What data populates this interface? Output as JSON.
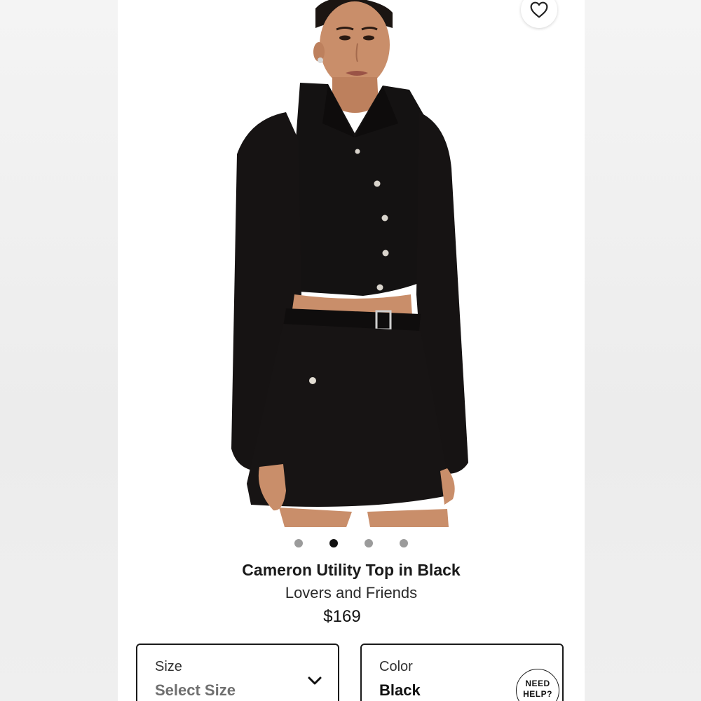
{
  "product": {
    "title": "Cameron Utility Top in Black",
    "brand": "Lovers and Friends",
    "price": "$169",
    "image_alt": "Model wearing black cropped utility top with matching mini skirt"
  },
  "gallery": {
    "total": 4,
    "active_index": 1
  },
  "size_selector": {
    "label": "Size",
    "value": "Select Size"
  },
  "color_selector": {
    "label": "Color",
    "value": "Black"
  },
  "help": {
    "line1": "NEED",
    "line2": "HELP?"
  },
  "icons": {
    "favorite": "heart-outline-icon",
    "dropdown": "chevron-down-icon"
  },
  "colors": {
    "garment": "#141212",
    "skin": "#c98e6a",
    "text": "#1a1a1a",
    "dot_active": "#111111",
    "dot_inactive": "#9b9b9b"
  }
}
